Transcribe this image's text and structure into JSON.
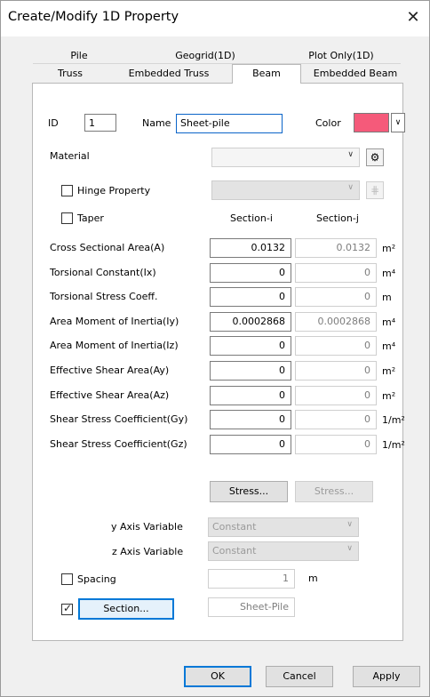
{
  "window": {
    "title": "Create/Modify 1D Property",
    "close_glyph": "✕"
  },
  "tabs": {
    "row1": [
      "Pile",
      "Geogrid(1D)",
      "Plot Only(1D)"
    ],
    "row2": [
      "Truss",
      "Embedded Truss",
      "Beam",
      "Embedded Beam"
    ],
    "selected": "Beam"
  },
  "header": {
    "id_label": "ID",
    "id_value": "1",
    "name_label": "Name",
    "name_value": "Sheet-pile",
    "color_label": "Color",
    "color_value": "#f55a7a"
  },
  "material": {
    "label": "Material",
    "value": ""
  },
  "hinge": {
    "label": "Hinge Property",
    "checked": false,
    "value": ""
  },
  "taper": {
    "label": "Taper",
    "checked": false,
    "col_i": "Section-i",
    "col_j": "Section-j"
  },
  "properties": [
    {
      "label": "Cross Sectional Area(A)",
      "i": "0.0132",
      "j": "0.0132",
      "unit": "m²"
    },
    {
      "label": "Torsional Constant(Ix)",
      "i": "0",
      "j": "0",
      "unit": "m⁴"
    },
    {
      "label": "Torsional Stress Coeff.",
      "i": "0",
      "j": "0",
      "unit": "m"
    },
    {
      "label": "Area Moment of Inertia(Iy)",
      "i": "0.0002868",
      "j": "0.0002868",
      "unit": "m⁴"
    },
    {
      "label": "Area Moment of Inertia(Iz)",
      "i": "0",
      "j": "0",
      "unit": "m⁴"
    },
    {
      "label": "Effective Shear Area(Ay)",
      "i": "0",
      "j": "0",
      "unit": "m²"
    },
    {
      "label": "Effective Shear Area(Az)",
      "i": "0",
      "j": "0",
      "unit": "m²"
    },
    {
      "label": "Shear Stress Coefficient(Gy)",
      "i": "0",
      "j": "0",
      "unit": "1/m²"
    },
    {
      "label": "Shear Stress Coefficient(Gz)",
      "i": "0",
      "j": "0",
      "unit": "1/m²"
    }
  ],
  "stress_buttons": {
    "i_label": "Stress...",
    "j_label": "Stress..."
  },
  "axis": {
    "y_label": "y Axis Variable",
    "y_value": "Constant",
    "z_label": "z Axis Variable",
    "z_value": "Constant"
  },
  "spacing": {
    "label": "Spacing",
    "checked": false,
    "value": "1",
    "unit": "m"
  },
  "section": {
    "checked": true,
    "button_label": "Section...",
    "value": "Sheet-Pile"
  },
  "footer": {
    "ok": "OK",
    "cancel": "Cancel",
    "apply": "Apply"
  },
  "icons": {
    "close": "close-icon",
    "material": "material-edit-icon",
    "hinge": "hinge-edit-icon",
    "dropdown": "chevron-down-icon",
    "check": "checkmark-icon"
  }
}
